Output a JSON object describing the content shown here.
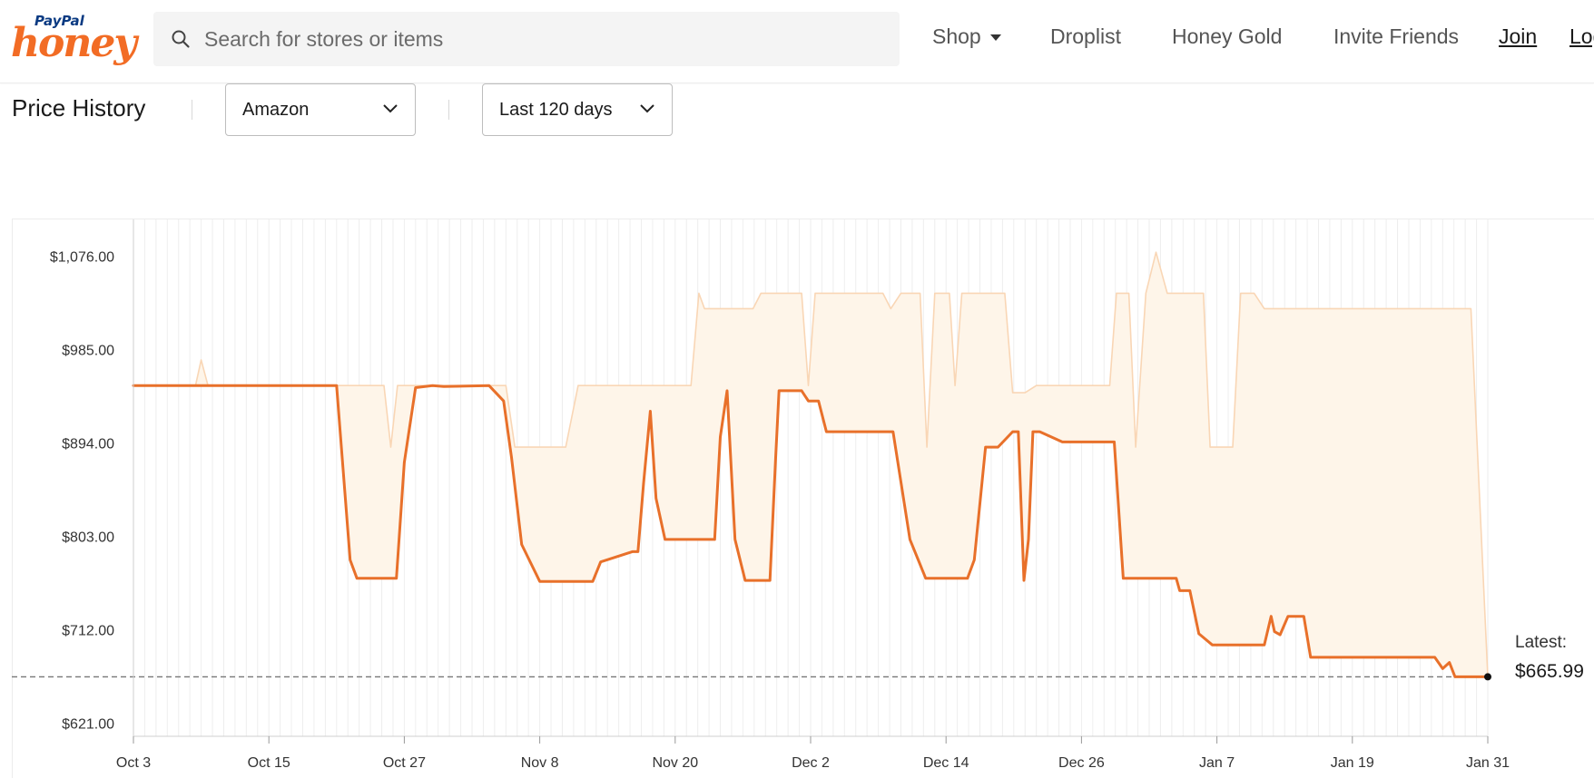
{
  "header": {
    "logo": {
      "top": "PayPal",
      "bottom": "honey"
    },
    "search": {
      "placeholder": "Search for stores or items",
      "value": ""
    },
    "nav": {
      "shop": "Shop",
      "droplist": "Droplist",
      "honey_gold": "Honey Gold",
      "invite_friends": "Invite Friends",
      "join": "Join",
      "login": "Log In"
    }
  },
  "price_history": {
    "title": "Price History",
    "store_select": "Amazon",
    "range_select": "Last 120 days",
    "latest_label": "Latest:",
    "latest_value": "$665.99"
  },
  "colors": {
    "accent": "#f26c25",
    "price_line": "#e8702a",
    "band_fill": "#fef5e9",
    "band_edge": "#f9d6b5",
    "paypal_blue": "#0a3a82"
  },
  "chart_data": {
    "type": "line",
    "title": "",
    "xlabel": "",
    "ylabel": "",
    "ylim": [
      608,
      1112
    ],
    "y_ticks": [
      "$621.00",
      "$712.00",
      "$803.00",
      "$894.00",
      "$985.00",
      "$1,076.00"
    ],
    "y_tick_values": [
      621,
      712,
      803,
      894,
      985,
      1076
    ],
    "x_ticks": [
      "Oct 3",
      "Oct 15",
      "Oct 27",
      "Nov 8",
      "Nov 20",
      "Dec 2",
      "Dec 14",
      "Dec 26",
      "Jan 7",
      "Jan 19",
      "Jan 31"
    ],
    "x_tick_days": [
      0,
      12,
      24,
      36,
      48,
      60,
      72,
      84,
      96,
      108,
      120
    ],
    "xlim": [
      0,
      120
    ],
    "grid": "vertical daily lines",
    "reference_line": {
      "value": 665.99,
      "style": "dashed"
    },
    "series": [
      {
        "role": "price",
        "x": [
          0,
          18,
          19.2,
          19.8,
          23.3,
          24,
          25,
          26.5,
          27.5,
          31.5,
          32.8,
          33.5,
          34.4,
          36,
          40.5,
          40.7,
          41.4,
          44.2,
          44.7,
          45.2,
          45.8,
          46.3,
          47.1,
          51.5,
          52,
          52.6,
          53.3,
          54.2,
          56.4,
          56.9,
          57.2,
          59.2,
          59.8,
          60.7,
          61.4,
          67.3,
          68.8,
          70.2,
          73.9,
          74.5,
          75.5,
          76.6,
          77.9,
          78.4,
          78.9,
          79.3,
          79.7,
          80.3,
          82.3,
          82.9,
          86.9,
          87.7,
          92.4,
          92.7,
          93.6,
          94.4,
          95.6,
          96.5,
          100.2,
          100.8,
          101.1,
          101.6,
          102.3,
          103.7,
          104.3,
          104.8,
          105.6,
          115.3,
          116,
          116.6,
          117.1,
          117.9,
          118.5,
          120
        ],
        "y": [
          950,
          950,
          780,
          762,
          762,
          875,
          948,
          950,
          949,
          950,
          935,
          880,
          795,
          759,
          759,
          759,
          778,
          788,
          788,
          855,
          925,
          840,
          800,
          800,
          900,
          945,
          800,
          760,
          760,
          880,
          945,
          945,
          935,
          935,
          905,
          905,
          800,
          762,
          762,
          780,
          890,
          890,
          905,
          905,
          760,
          800,
          905,
          905,
          895,
          895,
          895,
          762,
          762,
          750,
          750,
          708,
          697,
          697,
          697,
          725,
          710,
          707,
          725,
          725,
          685,
          685,
          685,
          685,
          674,
          680,
          665.99,
          665.99,
          665.99,
          665.99
        ]
      },
      {
        "role": "band_upper",
        "x": [
          0,
          5.5,
          6.0,
          6.6,
          22.2,
          22.8,
          23.4,
          24,
          33,
          33.8,
          34.4,
          38.3,
          39.4,
          40.1,
          49.4,
          50.1,
          50.6,
          51.4,
          54.9,
          55.6,
          59.2,
          59.8,
          60.4,
          61.2,
          66.4,
          67.1,
          68,
          69.7,
          70.3,
          71,
          72.3,
          72.8,
          73.4,
          77.2,
          77.9,
          79,
          80,
          86.5,
          87.1,
          88.2,
          88.8,
          89.7,
          90.6,
          91.6,
          94.8,
          95.4,
          96.5,
          97.4,
          98.1,
          99.3,
          100.2,
          104.4,
          105.1,
          107.8,
          108.5,
          109.5,
          118.1,
          118.5,
          120
        ],
        "y": [
          950,
          950,
          975,
          950,
          950,
          890,
          950,
          950,
          950,
          890,
          890,
          890,
          950,
          950,
          950,
          1040,
          1025,
          1025,
          1025,
          1040,
          1040,
          950,
          1040,
          1040,
          1040,
          1025,
          1040,
          1040,
          890,
          1040,
          1040,
          950,
          1040,
          1040,
          943,
          943,
          950,
          950,
          1040,
          1040,
          890,
          1040,
          1080,
          1040,
          1040,
          890,
          890,
          890,
          1040,
          1040,
          1025,
          1025,
          1025,
          1025,
          1025,
          1025,
          1025,
          1025,
          665.99
        ]
      }
    ]
  }
}
